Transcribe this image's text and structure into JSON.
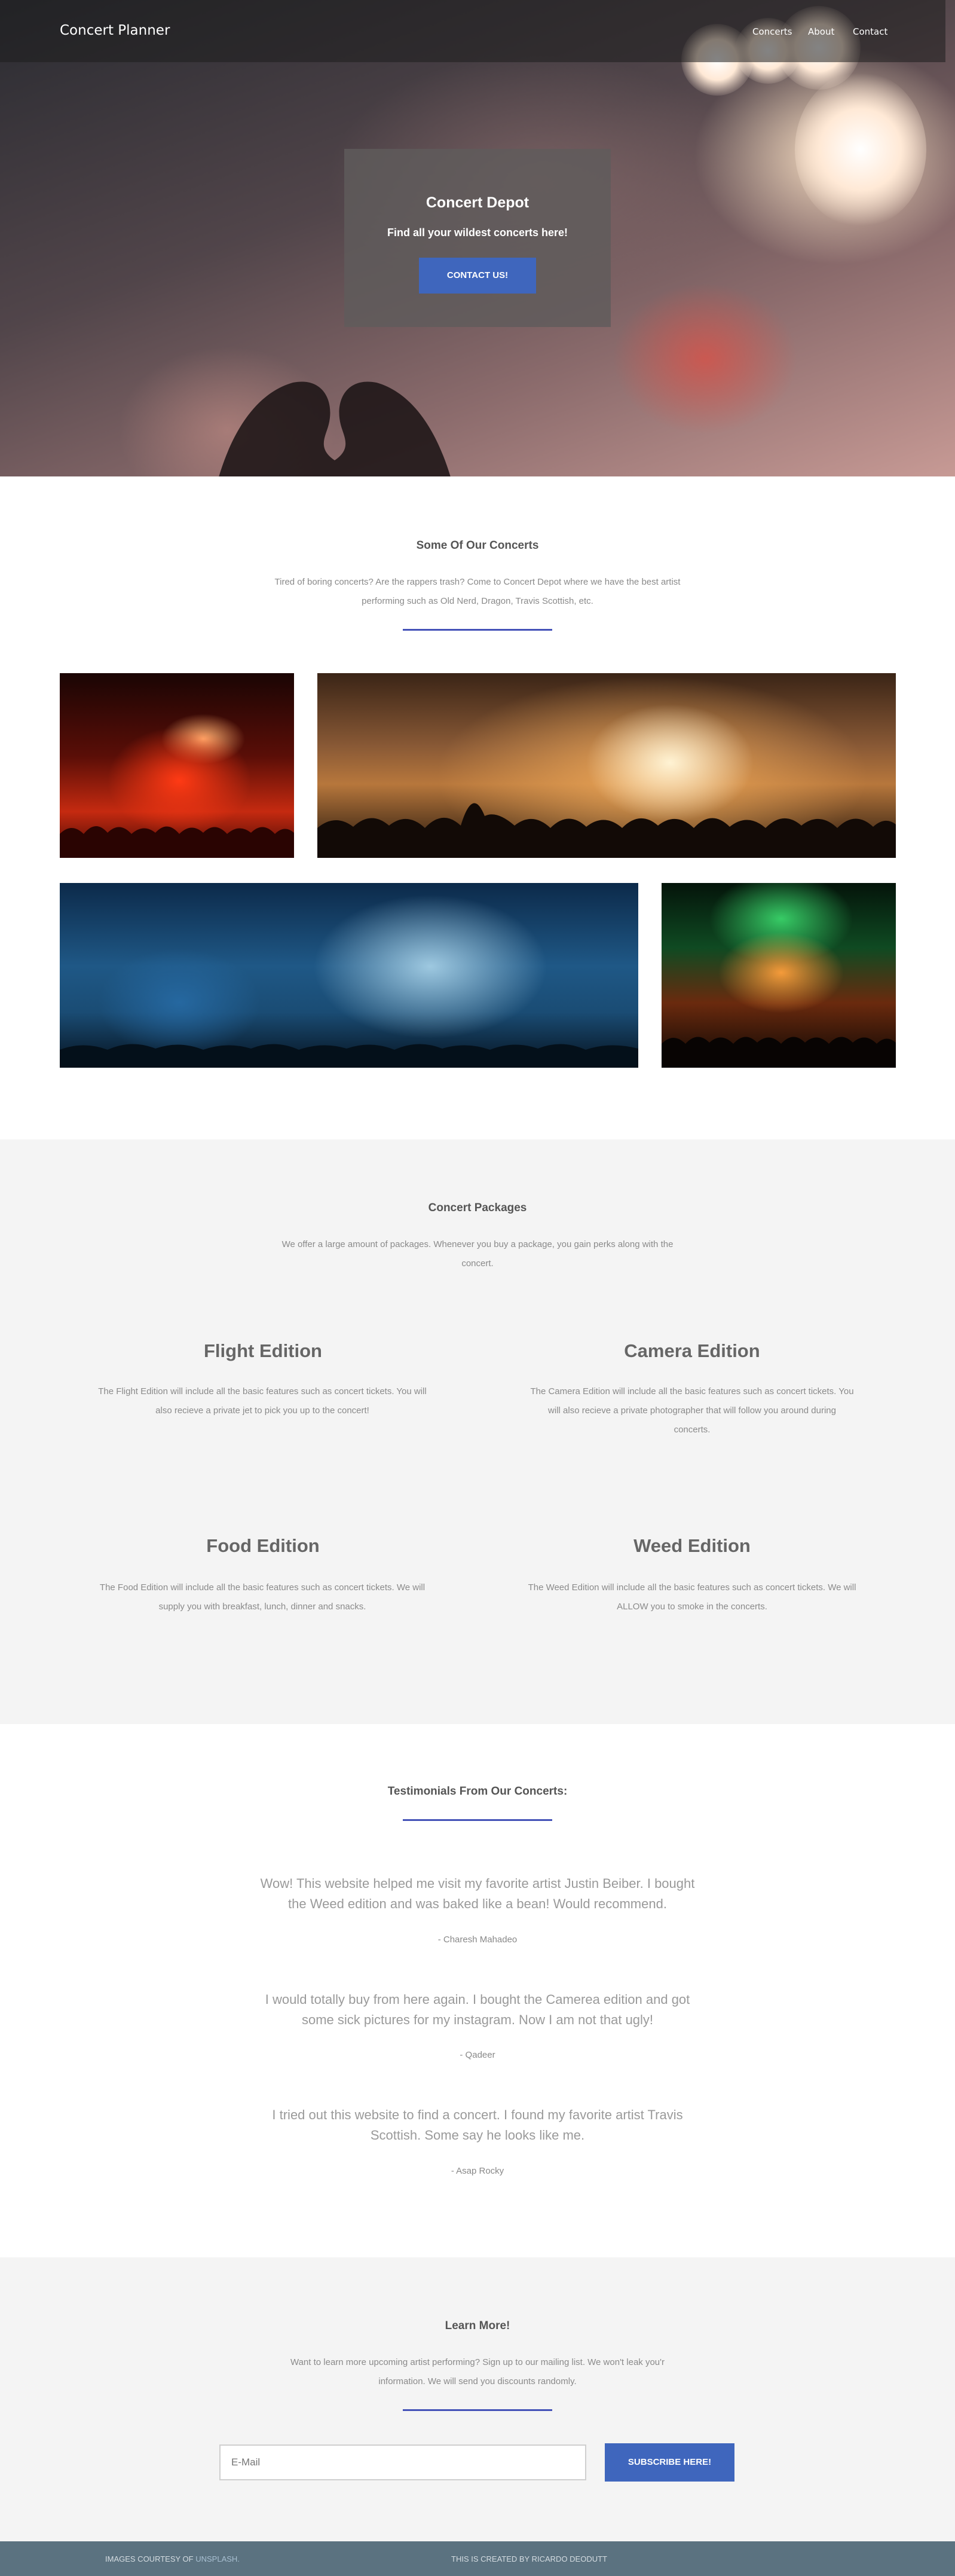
{
  "navbar": {
    "brand": "Concert Planner",
    "links": [
      "Concerts",
      "About",
      "Contact"
    ]
  },
  "hero": {
    "title": "Concert Depot",
    "subtitle": "Find all your wildest concerts here!",
    "button": "CONTACT US!"
  },
  "concerts": {
    "title": "Some Of Our Concerts",
    "text_line1": "Tired of boring concerts? Are the rappers trash? Come to Concert Depot where we have the best artist",
    "text_line2": "performing such as Old Nerd, Dragon, Travis Scottish, etc."
  },
  "packages": {
    "title": "Concert Packages",
    "text_line1": "We offer a large amount of packages. Whenever you buy a package, you gain perks along with the",
    "text_line2": "concert.",
    "items": [
      {
        "title": "Flight Edition",
        "line1": "The Flight Edition will include all the basic features such as concert tickets. You will",
        "line2": "also recieve a private jet to pick you up to the concert!",
        "line3": ""
      },
      {
        "title": "Camera Edition",
        "line1": "The Camera Edition will include all the basic features such as concert tickets. You",
        "line2": "will also recieve a private photographer that will follow you around during",
        "line3": "concerts."
      },
      {
        "title": "Food Edition",
        "line1": "The Food Edition will include all the basic features such as concert tickets. We will",
        "line2": "supply you with breakfast, lunch, dinner and snacks.",
        "line3": ""
      },
      {
        "title": "Weed Edition",
        "line1": "The Weed Edition will include all the basic features such as concert tickets. We will",
        "line2": "ALLOW you to smoke in the concerts.",
        "line3": ""
      }
    ]
  },
  "testimonials": {
    "title": "Testimonials From Our Concerts:",
    "items": [
      {
        "line1": "Wow! This website helped me visit my favorite artist Justin Beiber. I bought",
        "line2": "the Weed edition and was baked like a bean! Would recommend.",
        "author": "- Charesh Mahadeo"
      },
      {
        "line1": "I would totally buy from here again. I bought the Camerea edition and got",
        "line2": "some sick pictures for my instagram. Now I am not that ugly!",
        "author": "- Qadeer"
      },
      {
        "line1": "I tried out this website to find a concert. I found my favorite artist Travis",
        "line2": "Scottish. Some say he looks like me.",
        "author": "- Asap Rocky"
      }
    ]
  },
  "learn": {
    "title": "Learn More!",
    "text_line1": "Want to learn more upcoming artist performing? Sign up to our mailing list. We won't leak you'r",
    "text_line2": "information. We will send you discounts randomly.",
    "email_placeholder": "E-Mail",
    "button": "SUBSCRIBE HERE!"
  },
  "footer": {
    "left_prefix": "IMAGES COURTESY OF",
    "left_link": "UNSPLASH.",
    "right": "THIS IS CREATED BY RICARDO DEODUTT"
  }
}
